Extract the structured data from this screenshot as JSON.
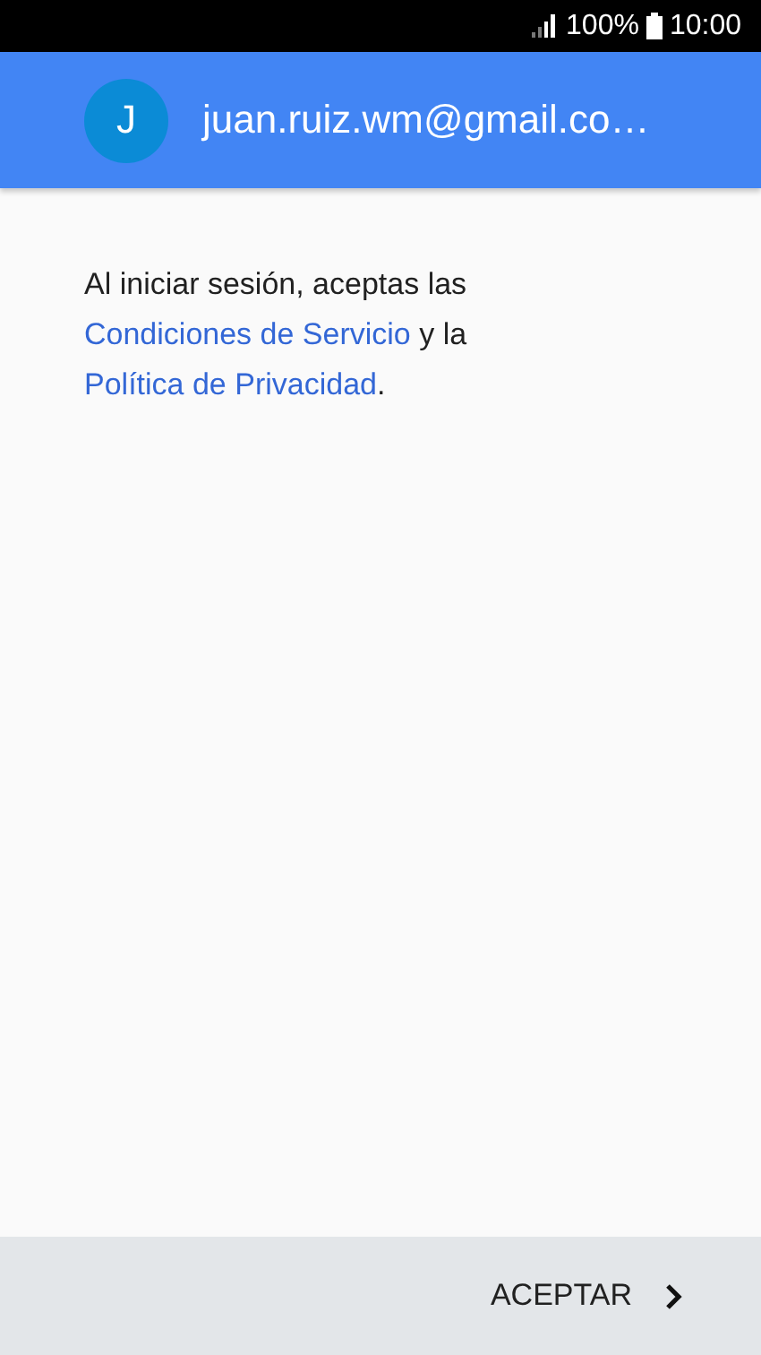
{
  "status_bar": {
    "battery": "100%",
    "time": "10:00"
  },
  "account": {
    "initial": "J",
    "email": "juan.ruiz.wm@gmail.co…"
  },
  "terms": [
    {
      "kind": "text",
      "text": "Al iniciar sesión, aceptas las "
    },
    {
      "kind": "link",
      "text": "Condiciones de Servicio"
    },
    {
      "kind": "text",
      "text": " y la "
    },
    {
      "kind": "link",
      "text": "Política de Privacidad"
    },
    {
      "kind": "text",
      "text": "."
    }
  ],
  "footer": {
    "button": "ACEPTAR"
  }
}
